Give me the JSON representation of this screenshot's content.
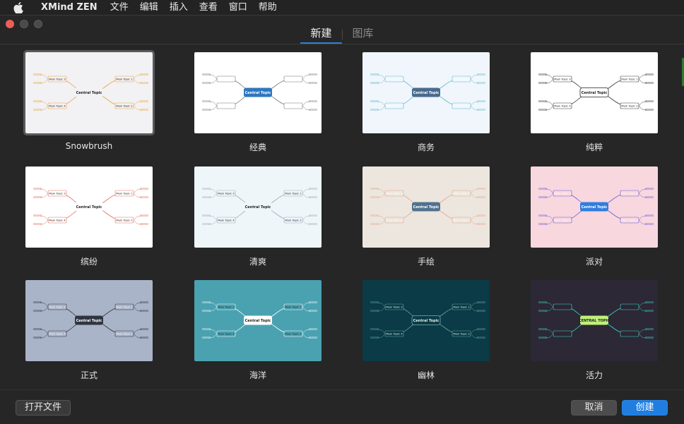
{
  "menubar": {
    "app_name": "XMind ZEN",
    "items": [
      "文件",
      "编辑",
      "插入",
      "查看",
      "窗口",
      "帮助"
    ]
  },
  "tabs": [
    {
      "label": "新建",
      "active": true
    },
    {
      "label": "图库",
      "active": false
    }
  ],
  "templates": [
    {
      "label": "Snowbrush",
      "bg": "#f2f1f3",
      "center_fill": "#f2f1f3",
      "center_stroke": "none",
      "center_text": "#222",
      "branch_color": "#e9a33d",
      "selected": true,
      "central": "Central Topic",
      "topics": [
        "Main Topic 3",
        "Main Topic 1",
        "Main Topic 4",
        "Main Topic 2"
      ]
    },
    {
      "label": "经典",
      "bg": "#ffffff",
      "center_fill": "#2f77c0",
      "center_stroke": "none",
      "center_text": "#ffffff",
      "branch_color": "#777",
      "selected": false,
      "central": "Central Topic",
      "topics": [
        "Main Topic 3",
        "Main Topic 1",
        "Main Topic 4",
        "Main Topic 2"
      ]
    },
    {
      "label": "商务",
      "bg": "#f0f6fb",
      "center_fill": "#4a6a8e",
      "center_stroke": "none",
      "center_text": "#ffffff",
      "branch_color": "#5fb7cf",
      "selected": false,
      "central": "Central Topic",
      "topics": [
        "Main Topic 3",
        "Main Topic 1",
        "Main Topic 4",
        "Main Topic 2"
      ]
    },
    {
      "label": "纯粹",
      "bg": "#ffffff",
      "center_fill": "#ffffff",
      "center_stroke": "#222",
      "center_text": "#222",
      "branch_color": "#333",
      "selected": false,
      "central": "Central Topic",
      "topics": [
        "Main Topic 3",
        "Main Topic 1",
        "Main Topic 4",
        "Main Topic 2"
      ]
    },
    {
      "label": "缤纷",
      "bg": "#ffffff",
      "center_fill": "#ffffff",
      "center_stroke": "none",
      "center_text": "#222",
      "branch_color": "#e86a5a",
      "selected": false,
      "central": "Central Topic",
      "topics": [
        "Main Topic 3",
        "Main Topic 1",
        "Main Topic 4",
        "Main Topic 2"
      ]
    },
    {
      "label": "清爽",
      "bg": "#eef6f9",
      "center_fill": "#eef6f9",
      "center_stroke": "none",
      "center_text": "#222",
      "branch_color": "#9ab",
      "selected": false,
      "central": "Central Topic",
      "topics": [
        "Main Topic 3",
        "Main Topic 1",
        "Main Topic 4",
        "Main Topic 2"
      ]
    },
    {
      "label": "手绘",
      "bg": "#ece6de",
      "center_fill": "#51728e",
      "center_stroke": "none",
      "center_text": "#ffffff",
      "branch_color": "#e4a58a",
      "selected": false,
      "central": "Central Topic",
      "topics": [
        "Main Topic 3",
        "Main Topic 1",
        "Main Topic 4",
        "Main Topic 2"
      ]
    },
    {
      "label": "派对",
      "bg": "#f8d7de",
      "center_fill": "#2f7ee0",
      "center_stroke": "none",
      "center_text": "#ffffff",
      "branch_color": "#6a5ad8",
      "selected": false,
      "central": "Central Topic",
      "topics": [
        "Main Topic 3",
        "Main Topic 1",
        "Main Topic 4",
        "Main Topic 2"
      ]
    },
    {
      "label": "正式",
      "bg": "#aab4c8",
      "center_fill": "#2f3541",
      "center_stroke": "none",
      "center_text": "#ffffff",
      "branch_color": "#2f3541",
      "selected": false,
      "central": "Central Topic",
      "topics": [
        "Main Topic 3",
        "Main Topic 1",
        "Main Topic 4",
        "Main Topic 2"
      ]
    },
    {
      "label": "海洋",
      "bg": "#4aa2b1",
      "center_fill": "#ffffff",
      "center_stroke": "none",
      "center_text": "#222",
      "branch_color": "#ffffff",
      "selected": false,
      "central": "Central Topic",
      "topics": [
        "Main Topic 3",
        "Main Topic 1",
        "Main Topic 4",
        "Main Topic 2"
      ]
    },
    {
      "label": "幽林",
      "bg": "#0b3b46",
      "center_fill": "#0b3b46",
      "center_stroke": "#6fb7b0",
      "center_text": "#e0f0ee",
      "branch_color": "#5faaa4",
      "selected": false,
      "central": "Central Topic",
      "topics": [
        "Main Topic 3",
        "Main Topic 1",
        "Main Topic 4",
        "Main Topic 2"
      ]
    },
    {
      "label": "活力",
      "bg": "#2c2836",
      "center_fill": "#bff07a",
      "center_stroke": "none",
      "center_text": "#222",
      "branch_color": "#3fd7c8",
      "selected": false,
      "central": "CENTRAL TOPIC",
      "topics": [
        "Main Topic 3",
        "Main Topic 1",
        "Main Topic 4",
        "Main Topic 2"
      ]
    }
  ],
  "footer": {
    "open_label": "打开文件",
    "cancel_label": "取消",
    "create_label": "创建"
  },
  "colors": {
    "accent": "#1f7ee0",
    "close": "#ec5f57"
  }
}
